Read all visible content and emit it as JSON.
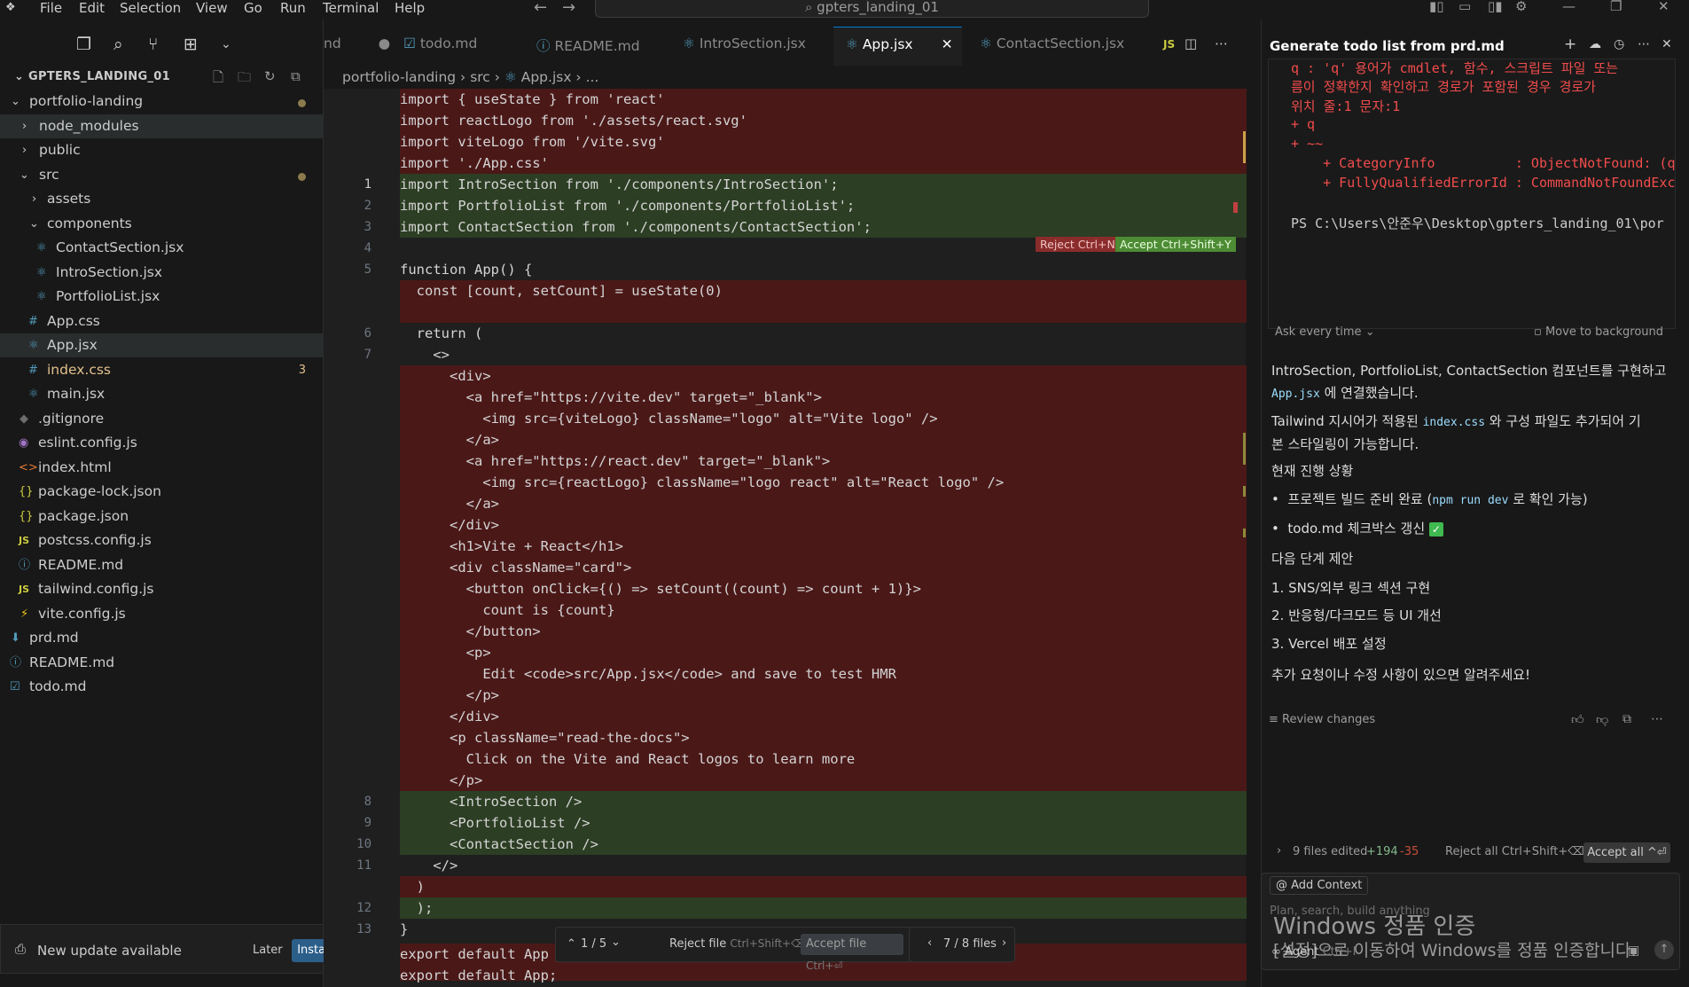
{
  "menu": [
    "File",
    "Edit",
    "Selection",
    "View",
    "Go",
    "Run",
    "Terminal",
    "Help"
  ],
  "command_center": "gpters_landing_01",
  "explorer": {
    "title": "GPTERS_LANDING_01",
    "items": [
      {
        "label": "portfolio-landing",
        "kind": "folder-open"
      },
      {
        "label": "node_modules",
        "kind": "folder"
      },
      {
        "label": "public",
        "kind": "folder"
      },
      {
        "label": "src",
        "kind": "folder-open"
      },
      {
        "label": "assets",
        "kind": "folder"
      },
      {
        "label": "components",
        "kind": "folder-open"
      },
      {
        "label": "ContactSection.jsx",
        "kind": "react"
      },
      {
        "label": "IntroSection.jsx",
        "kind": "react"
      },
      {
        "label": "PortfolioList.jsx",
        "kind": "react"
      },
      {
        "label": "App.css",
        "kind": "css"
      },
      {
        "label": "App.jsx",
        "kind": "react"
      },
      {
        "label": "index.css",
        "kind": "css",
        "badge": "3"
      },
      {
        "label": "main.jsx",
        "kind": "react"
      },
      {
        "label": ".gitignore",
        "kind": "git"
      },
      {
        "label": "eslint.config.js",
        "kind": "eslint"
      },
      {
        "label": "index.html",
        "kind": "html"
      },
      {
        "label": "package-lock.json",
        "kind": "json"
      },
      {
        "label": "package.json",
        "kind": "json"
      },
      {
        "label": "postcss.config.js",
        "kind": "js"
      },
      {
        "label": "README.md",
        "kind": "info"
      },
      {
        "label": "tailwind.config.js",
        "kind": "js"
      },
      {
        "label": "vite.config.js",
        "kind": "vite"
      },
      {
        "label": "prd.md",
        "kind": "md"
      },
      {
        "label": "README.md",
        "kind": "info"
      },
      {
        "label": "todo.md",
        "kind": "todo"
      }
    ]
  },
  "toast": {
    "text": "New update available",
    "later": "Later",
    "install": "Install Now"
  },
  "tabs": [
    {
      "label": "nd"
    },
    {
      "label": "todo.md"
    },
    {
      "label": "README.md"
    },
    {
      "label": "IntroSection.jsx"
    },
    {
      "label": "App.jsx"
    },
    {
      "label": "ContactSection.jsx"
    }
  ],
  "breadcrumb": {
    "p1": "portfolio-landing",
    "p2": "src",
    "p3": "App.jsx",
    "p4": "..."
  },
  "code": {
    "l_a": "import { useState } from 'react'",
    "l_b": "import reactLogo from './assets/react.svg'",
    "l_c": "import viteLogo from '/vite.svg'",
    "l_d": "import './App.css'",
    "l1": "import IntroSection from './components/IntroSection';",
    "l2": "import PortfolioList from './components/PortfolioList';",
    "l3": "import ContactSection from './components/ContactSection';",
    "l5": "function App() {",
    "l_e": "  const [count, setCount] = useState(0)",
    "l6": "  return (",
    "l7": "    <>",
    "l_f": "      <div>",
    "l_g": "        <a href=\"https://vite.dev\" target=\"_blank\">",
    "l_h": "          <img src={viteLogo} className=\"logo\" alt=\"Vite logo\" />",
    "l_i": "        </a>",
    "l_j": "        <a href=\"https://react.dev\" target=\"_blank\">",
    "l_k": "          <img src={reactLogo} className=\"logo react\" alt=\"React logo\" />",
    "l_l": "        </a>",
    "l_m": "      </div>",
    "l_n": "      <h1>Vite + React</h1>",
    "l_o": "      <div className=\"card\">",
    "l_p": "        <button onClick={() => setCount((count) => count + 1)}>",
    "l_q": "          count is {count}",
    "l_r": "        </button>",
    "l_s": "        <p>",
    "l_t": "          Edit <code>src/App.jsx</code> and save to test HMR",
    "l_u": "        </p>",
    "l_v": "      </div>",
    "l_w": "      <p className=\"read-the-docs\">",
    "l_x": "        Click on the Vite and React logos to learn more",
    "l_y": "      </p>",
    "l8": "      <IntroSection />",
    "l9": "      <PortfolioList />",
    "l10": "      <ContactSection />",
    "l11": "    </>",
    "l_z": "  )",
    "l12": "  );",
    "l13": "}",
    "l_end": "export default App",
    "l_end2": "export default App;"
  },
  "diff": {
    "reject": "Reject Ctrl+N",
    "accept": "Accept Ctrl+Shift+Y",
    "counter": "1 / 5",
    "reject_file": "Reject file",
    "reject_file_key": "Ctrl+Shift+⌫",
    "accept_file": "Accept file",
    "accept_file_key": "Ctrl+⏎",
    "files_nav": "7 / 8 files"
  },
  "chat": {
    "title": "Generate todo list from prd.md",
    "terminal": {
      "t1": "q : 'q' 용어가 cmdlet, 함수, 스크립트 파일 또는",
      "t2": "름이 정확한지 확인하고 경로가 포함된 경우 경로가",
      "t3": "위치 줄:1 문자:1",
      "t4": "+ q",
      "t5": "+ ~~",
      "t6": "    + CategoryInfo          : ObjectNotFound: (q",
      "t7": "    + FullyQualifiedErrorId : CommandNotFoundExc",
      "t8": "PS C:\\Users\\안준우\\Desktop\\gpters_landing_01\\por",
      "mode": "Ask every time",
      "bg": "Move to background"
    },
    "msg1a": "IntroSection, PortfolioList, ContactSection 컴포넌트를 구현하고",
    "msg1b_code": "App.jsx",
    "msg1b": " 에 연결했습니다.",
    "msg2a": "Tailwind 지시어가 적용된 ",
    "msg2a_code": "index.css",
    "msg2b": " 와 구성 파일도 추가되어 기",
    "msg2c": "본 스타일링이 가능합니다.",
    "status_title": "현재 진행 상황",
    "bullet1a": "프로젝트 빌드 준비 완료 (",
    "bullet1_code": "npm run dev",
    "bullet1b": " 로 확인 가능)",
    "bullet2": "todo.md 체크박스 갱신",
    "next_title": "다음 단계 제안",
    "step1": "SNS/외부 링크 섹션 구현",
    "step2": "반응형/다크모드 등 UI 개선",
    "step3": "Vercel 배포 설정",
    "closing": "추가 요청이나 수정 사항이 있으면 알려주세요!",
    "review": "Review changes",
    "files_edited": "9 files edited",
    "added": "+194",
    "removed": "-35",
    "reject_all": "Reject all Ctrl+Shift+⌫",
    "accept_all": "Accept all ^⏎",
    "add_context": "Add Context",
    "placeholder": "Plan, search, build anything",
    "agent": "Agent",
    "agent_key": "Ctrl+I",
    "watermark1": "Windows 정품 인증",
    "watermark2": "[설정]으로 이동하여 Windows를 정품 인증합니다."
  }
}
